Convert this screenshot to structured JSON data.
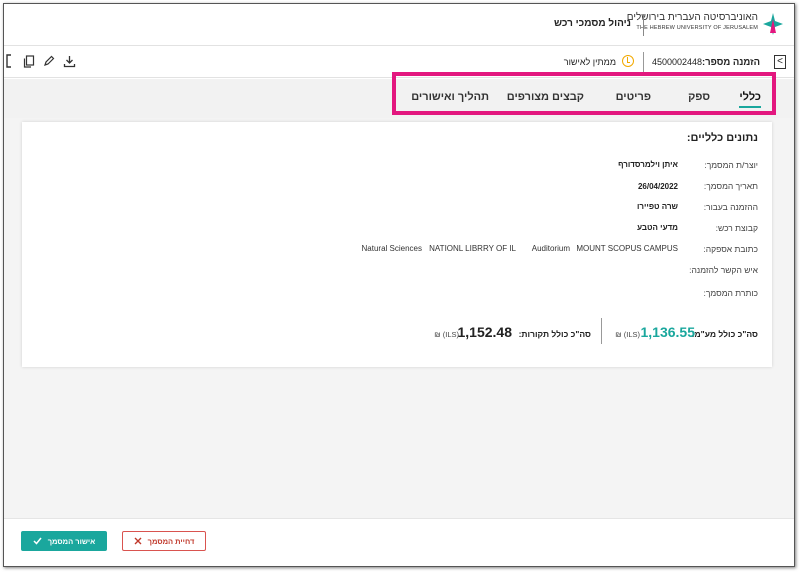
{
  "header": {
    "university_he": "האוניברסיטה העברית בירושלים",
    "university_en": "THE HEBREW UNIVERSITY OF JERUSALEM",
    "app_title": "ניהול מסמכי רכש"
  },
  "subbar": {
    "order_label": "הזמנה מספר:",
    "order_number": "4500002448",
    "status": "ממתין לאישור",
    "status_icon": "clock-icon",
    "status_color": "#f2a900"
  },
  "toolbar": {
    "icons": [
      "download-icon",
      "edit-icon",
      "copy-icon",
      "document-icon"
    ]
  },
  "tabs": [
    {
      "label": "כללי",
      "active": true
    },
    {
      "label": "ספק",
      "active": false
    },
    {
      "label": "פריטים",
      "active": false
    },
    {
      "label": "קבצים מצורפים",
      "active": false
    },
    {
      "label": "תהליך ואישורים",
      "active": false
    }
  ],
  "general": {
    "title": "נתונים כלליים:",
    "fields": [
      {
        "label": "יוצר/ת המסמך:",
        "value": "איתן וילמרסדורף"
      },
      {
        "label": "תאריך המסמך:",
        "value": "26/04/2022"
      },
      {
        "label": "ההזמנה בעבור:",
        "value": "שרה טפיירו"
      },
      {
        "label": "קבוצת רכש:",
        "value": "מדעי הטבע"
      },
      {
        "label": "כתובת אספקה:",
        "value": ""
      },
      {
        "label": "איש הקשר להזמנה:",
        "value": ""
      },
      {
        "label": "כותרת המסמך:",
        "value": ""
      }
    ],
    "supply_address": [
      "MOUNT SCOPUS CAMPUS",
      "Auditorium",
      "NATIONL LIBRRY OF IL",
      "Natural Sciences"
    ]
  },
  "totals": {
    "with_vat_label": "סה\"כ כולל מע\"מ:",
    "with_vat_value": "1,136.55",
    "with_vat_currency": "₪ (ILS)",
    "budget_label": "סה\"כ כולל תקורות:",
    "budget_value": "1,152.48",
    "budget_currency": "₪ (ILS)",
    "accent_color": "#1aa79d"
  },
  "footer": {
    "approve_label": "אישור המסמך",
    "reject_label": "דחיית המסמך"
  }
}
